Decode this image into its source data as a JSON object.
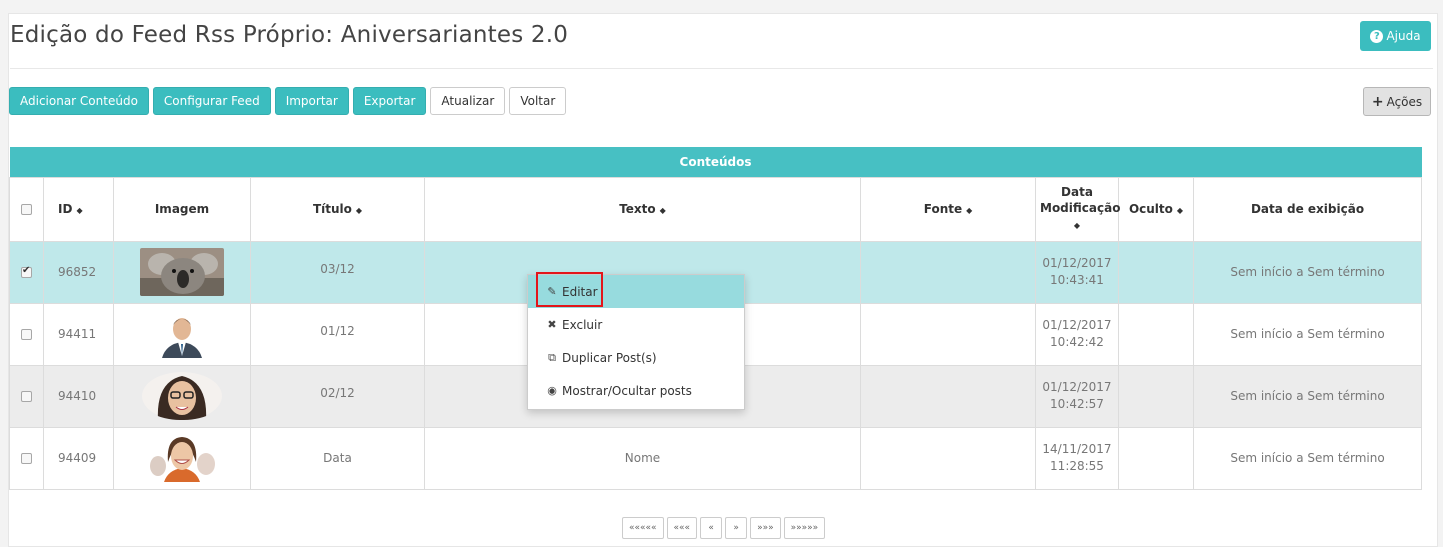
{
  "page": {
    "title": "Edição do Feed Rss Próprio: Aniversariantes 2.0",
    "help_label": "Ajuda"
  },
  "toolbar": {
    "buttons": [
      "Adicionar Conteúdo",
      "Configurar Feed",
      "Importar",
      "Exportar",
      "Atualizar",
      "Voltar"
    ],
    "actions_label": "Ações"
  },
  "table": {
    "band_title": "Conteúdos",
    "headers": {
      "id": "ID",
      "imagem": "Imagem",
      "titulo": "Título",
      "texto": "Texto",
      "fonte": "Fonte",
      "data_mod_1": "Data",
      "data_mod_2": "Modificação",
      "oculto": "Oculto",
      "data_exibicao": "Data de exibição"
    },
    "rows": [
      {
        "checked": true,
        "id": "96852",
        "titulo": "03/12",
        "texto": "",
        "fonte": "",
        "date": "01/12/2017",
        "time": "10:43:41",
        "oculto": "",
        "exibicao": "Sem início a Sem término"
      },
      {
        "checked": false,
        "id": "94411",
        "titulo": "01/12",
        "texto": "",
        "fonte": "",
        "date": "01/12/2017",
        "time": "10:42:42",
        "oculto": "",
        "exibicao": "Sem início a Sem término"
      },
      {
        "checked": false,
        "id": "94410",
        "titulo": "02/12",
        "texto": "",
        "fonte": "",
        "date": "01/12/2017",
        "time": "10:42:57",
        "oculto": "",
        "exibicao": "Sem início a Sem término"
      },
      {
        "checked": false,
        "id": "94409",
        "titulo": "Data",
        "texto": "Nome",
        "fonte": "",
        "date": "14/11/2017",
        "time": "11:28:55",
        "oculto": "",
        "exibicao": "Sem início a Sem término"
      }
    ]
  },
  "context_menu": {
    "items": [
      "Editar",
      "Excluir",
      "Duplicar Post(s)",
      "Mostrar/Ocultar posts"
    ]
  },
  "pager": {
    "buttons": [
      "«««««",
      "«««",
      "«",
      "»",
      "»»»",
      "»»»»»"
    ]
  },
  "colors": {
    "teal": "#3bbdbf",
    "selected_row": "#bfe8ea",
    "highlight_box": "#e3151a"
  }
}
